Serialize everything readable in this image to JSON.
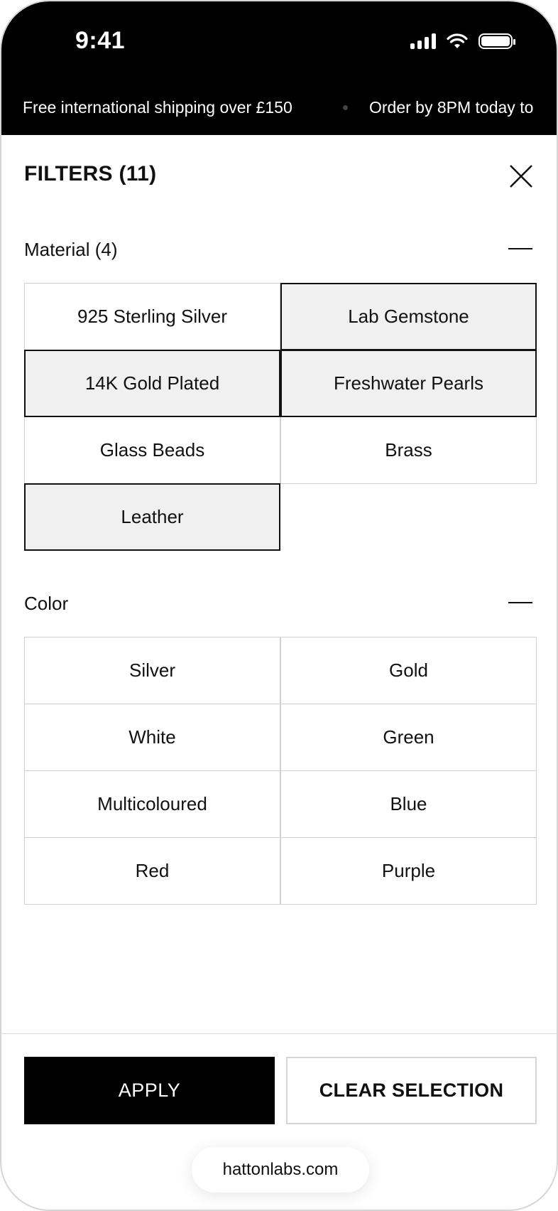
{
  "status_bar": {
    "time": "9:41"
  },
  "announcement": {
    "messages": [
      "Free international shipping over £150",
      "Order by 8PM today to"
    ]
  },
  "header": {
    "title": "FILTERS (11)",
    "close_icon": "close-icon"
  },
  "material": {
    "title": "Material (4)",
    "collapse_icon": "minus-icon",
    "options": [
      {
        "label": "925 Sterling Silver",
        "selected": false
      },
      {
        "label": "Lab Gemstone",
        "selected": true
      },
      {
        "label": "14K Gold Plated",
        "selected": true
      },
      {
        "label": "Freshwater Pearls",
        "selected": true
      },
      {
        "label": "Glass Beads",
        "selected": false
      },
      {
        "label": "Brass",
        "selected": false
      },
      {
        "label": "Leather",
        "selected": true
      }
    ]
  },
  "color": {
    "title": "Color",
    "collapse_icon": "minus-icon",
    "options": [
      {
        "label": "Silver",
        "selected": false
      },
      {
        "label": "Gold",
        "selected": false
      },
      {
        "label": "White",
        "selected": false
      },
      {
        "label": "Green",
        "selected": false
      },
      {
        "label": "Multicoloured",
        "selected": false
      },
      {
        "label": "Blue",
        "selected": false
      },
      {
        "label": "Red",
        "selected": false
      },
      {
        "label": "Purple",
        "selected": false
      }
    ]
  },
  "footer": {
    "apply_label": "APPLY",
    "clear_label": "CLEAR SELECTION",
    "url": "hattonlabs.com"
  },
  "colors": {
    "accent": "#000000",
    "selected_bg": "#f0f0f0",
    "border": "#d0d0d0"
  }
}
